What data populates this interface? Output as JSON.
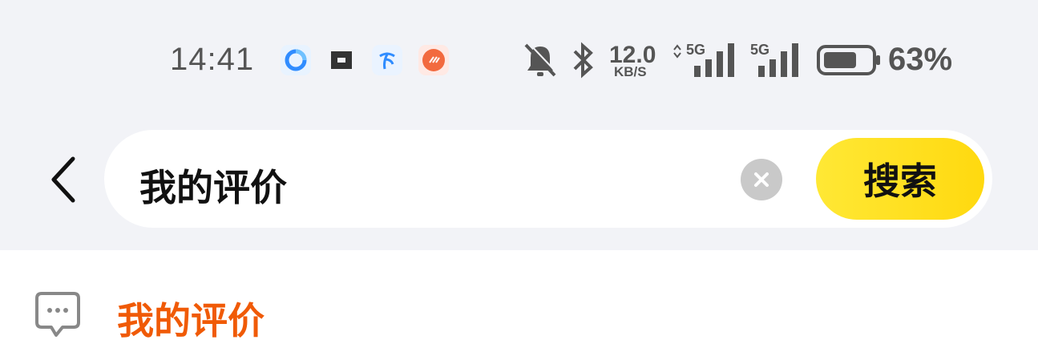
{
  "status_bar": {
    "time": "14:41",
    "net_speed": "12.0",
    "net_speed_unit": "KB/S",
    "signal1_label": "5G",
    "signal2_label": "5G",
    "battery_percent": "63%",
    "icons": [
      "cloud-app-icon",
      "link-app-icon",
      "telecom-app-icon",
      "music-app-icon",
      "mute-bell-icon",
      "bluetooth-icon",
      "signal-icon",
      "battery-icon"
    ]
  },
  "search": {
    "query": "我的评价",
    "search_button_label": "搜索"
  },
  "suggestions": [
    {
      "label": "我的评价",
      "icon": "comment-icon"
    }
  ],
  "colors": {
    "background": "#f2f3f7",
    "search_button": "#ffdf1f",
    "suggestion_highlight": "#f05a06"
  }
}
